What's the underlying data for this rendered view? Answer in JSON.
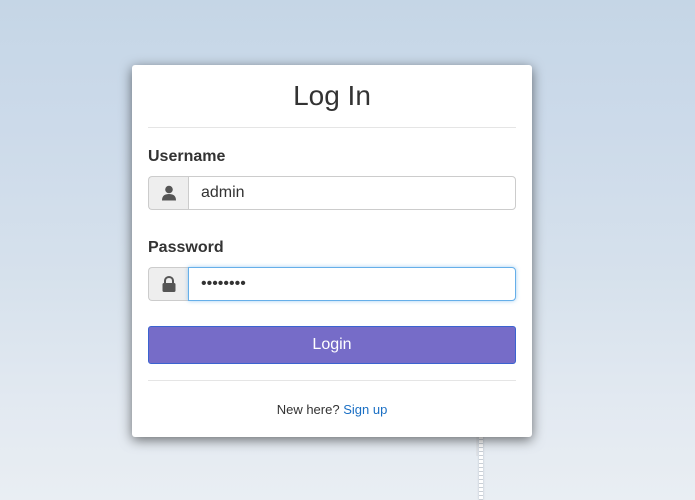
{
  "login_form": {
    "title": "Log In",
    "username": {
      "label": "Username",
      "icon": "user-icon",
      "value": "admin",
      "placeholder": ""
    },
    "password": {
      "label": "Password",
      "icon": "lock-icon",
      "value": "••••••••",
      "placeholder": ""
    },
    "submit_label": "Login",
    "footer": {
      "prompt": "New here?",
      "link_label": "Sign up"
    }
  },
  "colors": {
    "button": "#766cc8",
    "link": "#1a6fc4",
    "focus_border": "#66afe9"
  }
}
